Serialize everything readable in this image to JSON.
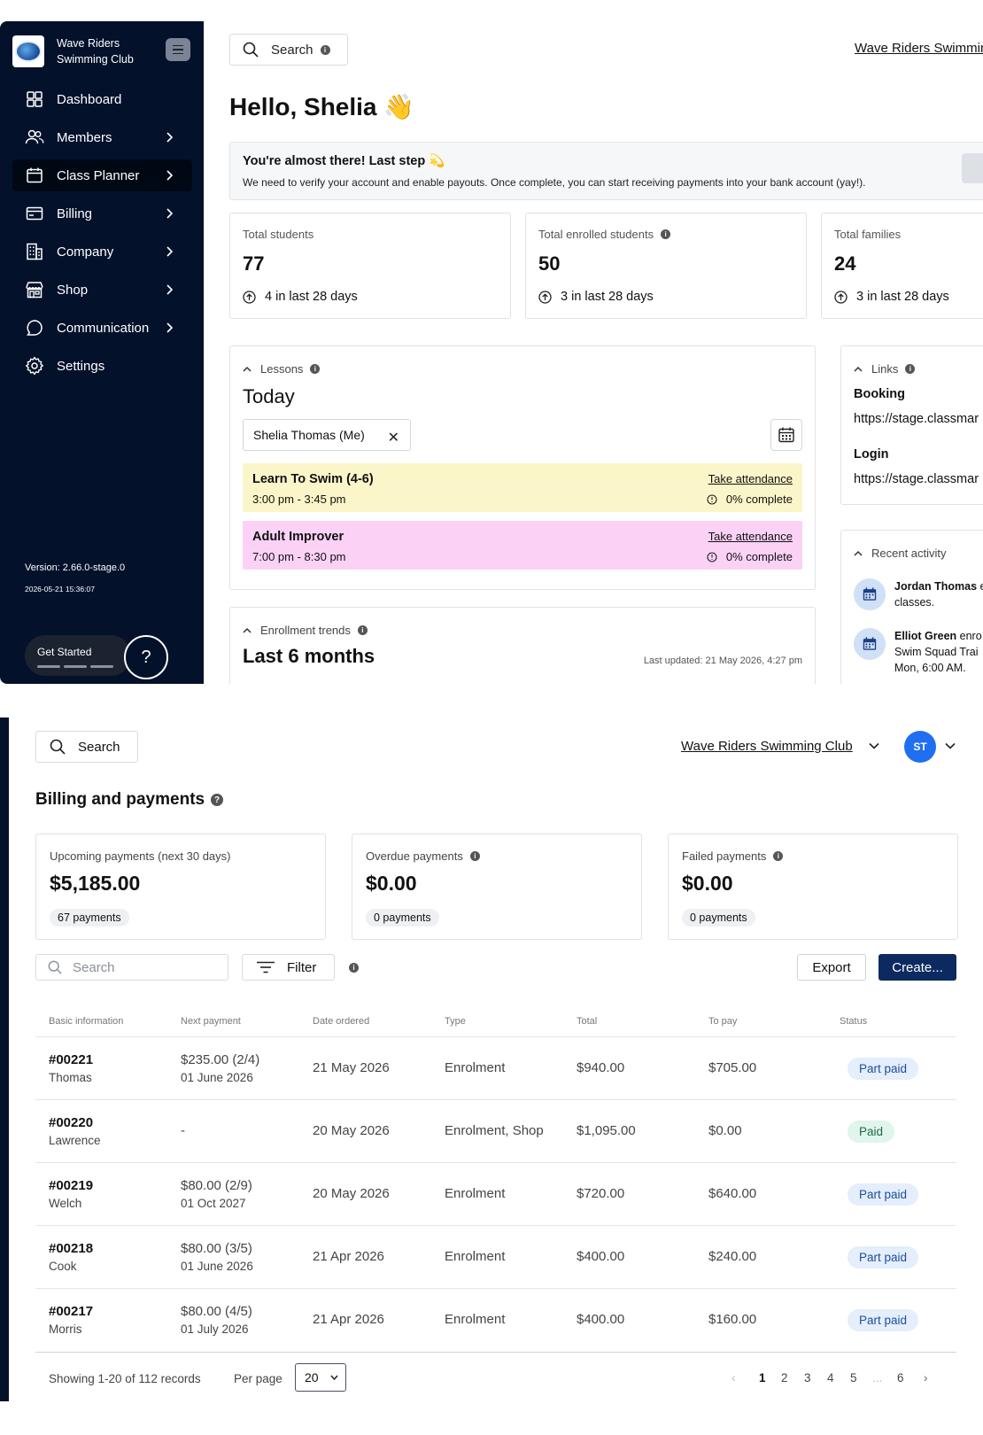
{
  "dashboard": {
    "sidebar": {
      "club_name": "Wave Riders Swimming Club",
      "items": [
        {
          "label": "Dashboard",
          "icon": "dashboard-icon",
          "chevron": false
        },
        {
          "label": "Members",
          "icon": "members-icon",
          "chevron": true
        },
        {
          "label": "Class Planner",
          "icon": "calendar-icon",
          "chevron": true,
          "active": true
        },
        {
          "label": "Billing",
          "icon": "billing-icon",
          "chevron": true
        },
        {
          "label": "Company",
          "icon": "building-icon",
          "chevron": true
        },
        {
          "label": "Shop",
          "icon": "shop-icon",
          "chevron": true
        },
        {
          "label": "Communication",
          "icon": "chat-icon",
          "chevron": true
        },
        {
          "label": "Settings",
          "icon": "gear-icon",
          "chevron": false
        }
      ],
      "version": "Version: 2.66.0-stage.0",
      "version_date": "2026-05-21 15:36:07",
      "get_started": "Get Started",
      "help": "?"
    },
    "header": {
      "search": "Search",
      "club_link": "Wave Riders Swimmin"
    },
    "greeting": "Hello, Shelia 👋",
    "banner": {
      "title": "You're almost there! Last step 💫",
      "text": "We need to verify your account and enable payouts. Once complete, you can start receiving payments into your bank account (yay!)."
    },
    "stats": [
      {
        "label": "Total students",
        "value": "77",
        "delta": "4 in last 28 days",
        "info": false
      },
      {
        "label": "Total enrolled students",
        "value": "50",
        "delta": "3 in last 28 days",
        "info": true
      },
      {
        "label": "Total families",
        "value": "24",
        "delta": "3 in last 28 days",
        "info": false
      }
    ],
    "lessons": {
      "heading": "Lessons",
      "title": "Today",
      "filter_chip": "Shelia Thomas (Me)",
      "items": [
        {
          "name": "Learn To Swim (4-6)",
          "time": "3:00 pm - 3:45 pm",
          "action": "Take attendance",
          "progress": "0% complete",
          "color": "#fbf6c9"
        },
        {
          "name": "Adult Improver",
          "time": "7:00 pm - 8:30 pm",
          "action": "Take attendance",
          "progress": "0% complete",
          "color": "#fbd2f6"
        }
      ]
    },
    "enrollment": {
      "heading": "Enrollment trends",
      "title": "Last 6 months",
      "updated": "Last updated: 21 May 2026, 4:27 pm"
    },
    "links": {
      "heading": "Links",
      "booking_label": "Booking",
      "booking_url": "https://stage.classmar",
      "login_label": "Login",
      "login_url": "https://stage.classmar"
    },
    "activity": {
      "heading": "Recent activity",
      "items": [
        {
          "name": "Jordan Thomas",
          "rest1": " e",
          "line2": "classes.",
          "line3": ""
        },
        {
          "name": "Elliot Green",
          "rest1": " enro",
          "line2": "Swim Squad Trai",
          "line3": "Mon, 6:00 AM."
        }
      ]
    }
  },
  "billing": {
    "header": {
      "search": "Search",
      "club_link": "Wave Riders Swimming Club",
      "avatar": "ST"
    },
    "title": "Billing and payments",
    "cards": [
      {
        "label": "Upcoming payments (next 30 days)",
        "value": "$5,185.00",
        "badge": "67 payments",
        "info": false
      },
      {
        "label": "Overdue payments",
        "value": "$0.00",
        "badge": "0 payments",
        "info": true
      },
      {
        "label": "Failed payments",
        "value": "$0.00",
        "badge": "0 payments",
        "info": true
      }
    ],
    "toolbar": {
      "search_placeholder": "Search",
      "filter": "Filter",
      "export": "Export",
      "create": "Create..."
    },
    "columns": [
      "Basic information",
      "Next payment",
      "Date ordered",
      "Type",
      "Total",
      "To pay",
      "Status"
    ],
    "rows": [
      {
        "id": "#00221",
        "name": "Thomas",
        "next_amount": "$235.00 (2/4)",
        "next_date": "01 June 2026",
        "date": "21 May 2026",
        "type": "Enrolment",
        "total": "$940.00",
        "to_pay": "$705.00",
        "status": "Part paid"
      },
      {
        "id": "#00220",
        "name": "Lawrence",
        "next_amount": "-",
        "next_date": "",
        "date": "20 May 2026",
        "type": "Enrolment, Shop",
        "total": "$1,095.00",
        "to_pay": "$0.00",
        "status": "Paid"
      },
      {
        "id": "#00219",
        "name": "Welch",
        "next_amount": "$80.00 (2/9)",
        "next_date": "01 Oct 2027",
        "date": "20 May 2026",
        "type": "Enrolment",
        "total": "$720.00",
        "to_pay": "$640.00",
        "status": "Part paid"
      },
      {
        "id": "#00218",
        "name": "Cook",
        "next_amount": "$80.00 (3/5)",
        "next_date": "01 June 2026",
        "date": "21 Apr 2026",
        "type": "Enrolment",
        "total": "$400.00",
        "to_pay": "$240.00",
        "status": "Part paid"
      },
      {
        "id": "#00217",
        "name": "Morris",
        "next_amount": "$80.00 (4/5)",
        "next_date": "01 July 2026",
        "date": "21 Apr 2026",
        "type": "Enrolment",
        "total": "$400.00",
        "to_pay": "$160.00",
        "status": "Part paid"
      }
    ],
    "footer": {
      "showing": "Showing 1-20 of 112 records",
      "per_page_label": "Per page",
      "per_page": "20",
      "pages": [
        "1",
        "2",
        "3",
        "4",
        "5",
        "...",
        "6"
      ],
      "current_page": "1"
    }
  }
}
